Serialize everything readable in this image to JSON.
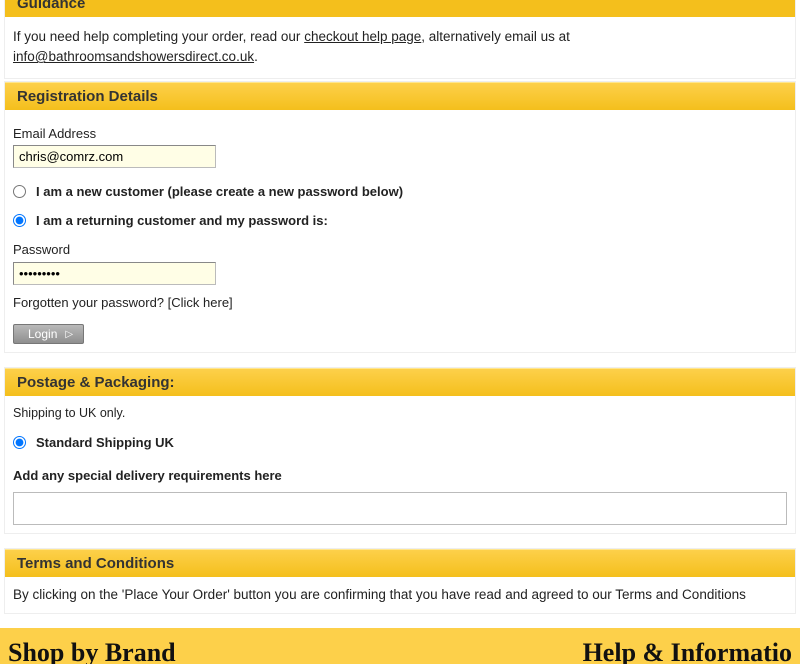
{
  "guidance": {
    "title": "Guidance",
    "help_prefix": "If you need help completing your order, read our ",
    "help_link": "checkout help page",
    "help_middle": ", alternatively email us at ",
    "help_email": "info@bathroomsandshowersdirect.co.uk",
    "help_suffix": "."
  },
  "registration": {
    "title": "Registration Details",
    "email_label": "Email Address",
    "email_value": "chris@comrz.com",
    "radio_new": "I am a new customer (please create a new password below)",
    "radio_returning": "I am a returning customer and my password is:",
    "password_label": "Password",
    "password_value": "•••••••••",
    "forgot_prefix": "Forgotten your password? [",
    "forgot_link": "Click here",
    "forgot_suffix": "]",
    "login_label": "Login"
  },
  "postage": {
    "title": "Postage & Packaging:",
    "ship_note": "Shipping to UK only.",
    "standard_label": "Standard Shipping UK",
    "delivery_label": "Add any special delivery requirements here",
    "delivery_value": ""
  },
  "terms": {
    "title": "Terms and Conditions",
    "text_prefix": "By clicking on the 'Place Your Order' button you are confirming that you have read and agreed to our ",
    "text_link": "Terms and Conditions"
  },
  "footer": {
    "left": "Shop by Brand",
    "right": "Help & Informatio"
  }
}
